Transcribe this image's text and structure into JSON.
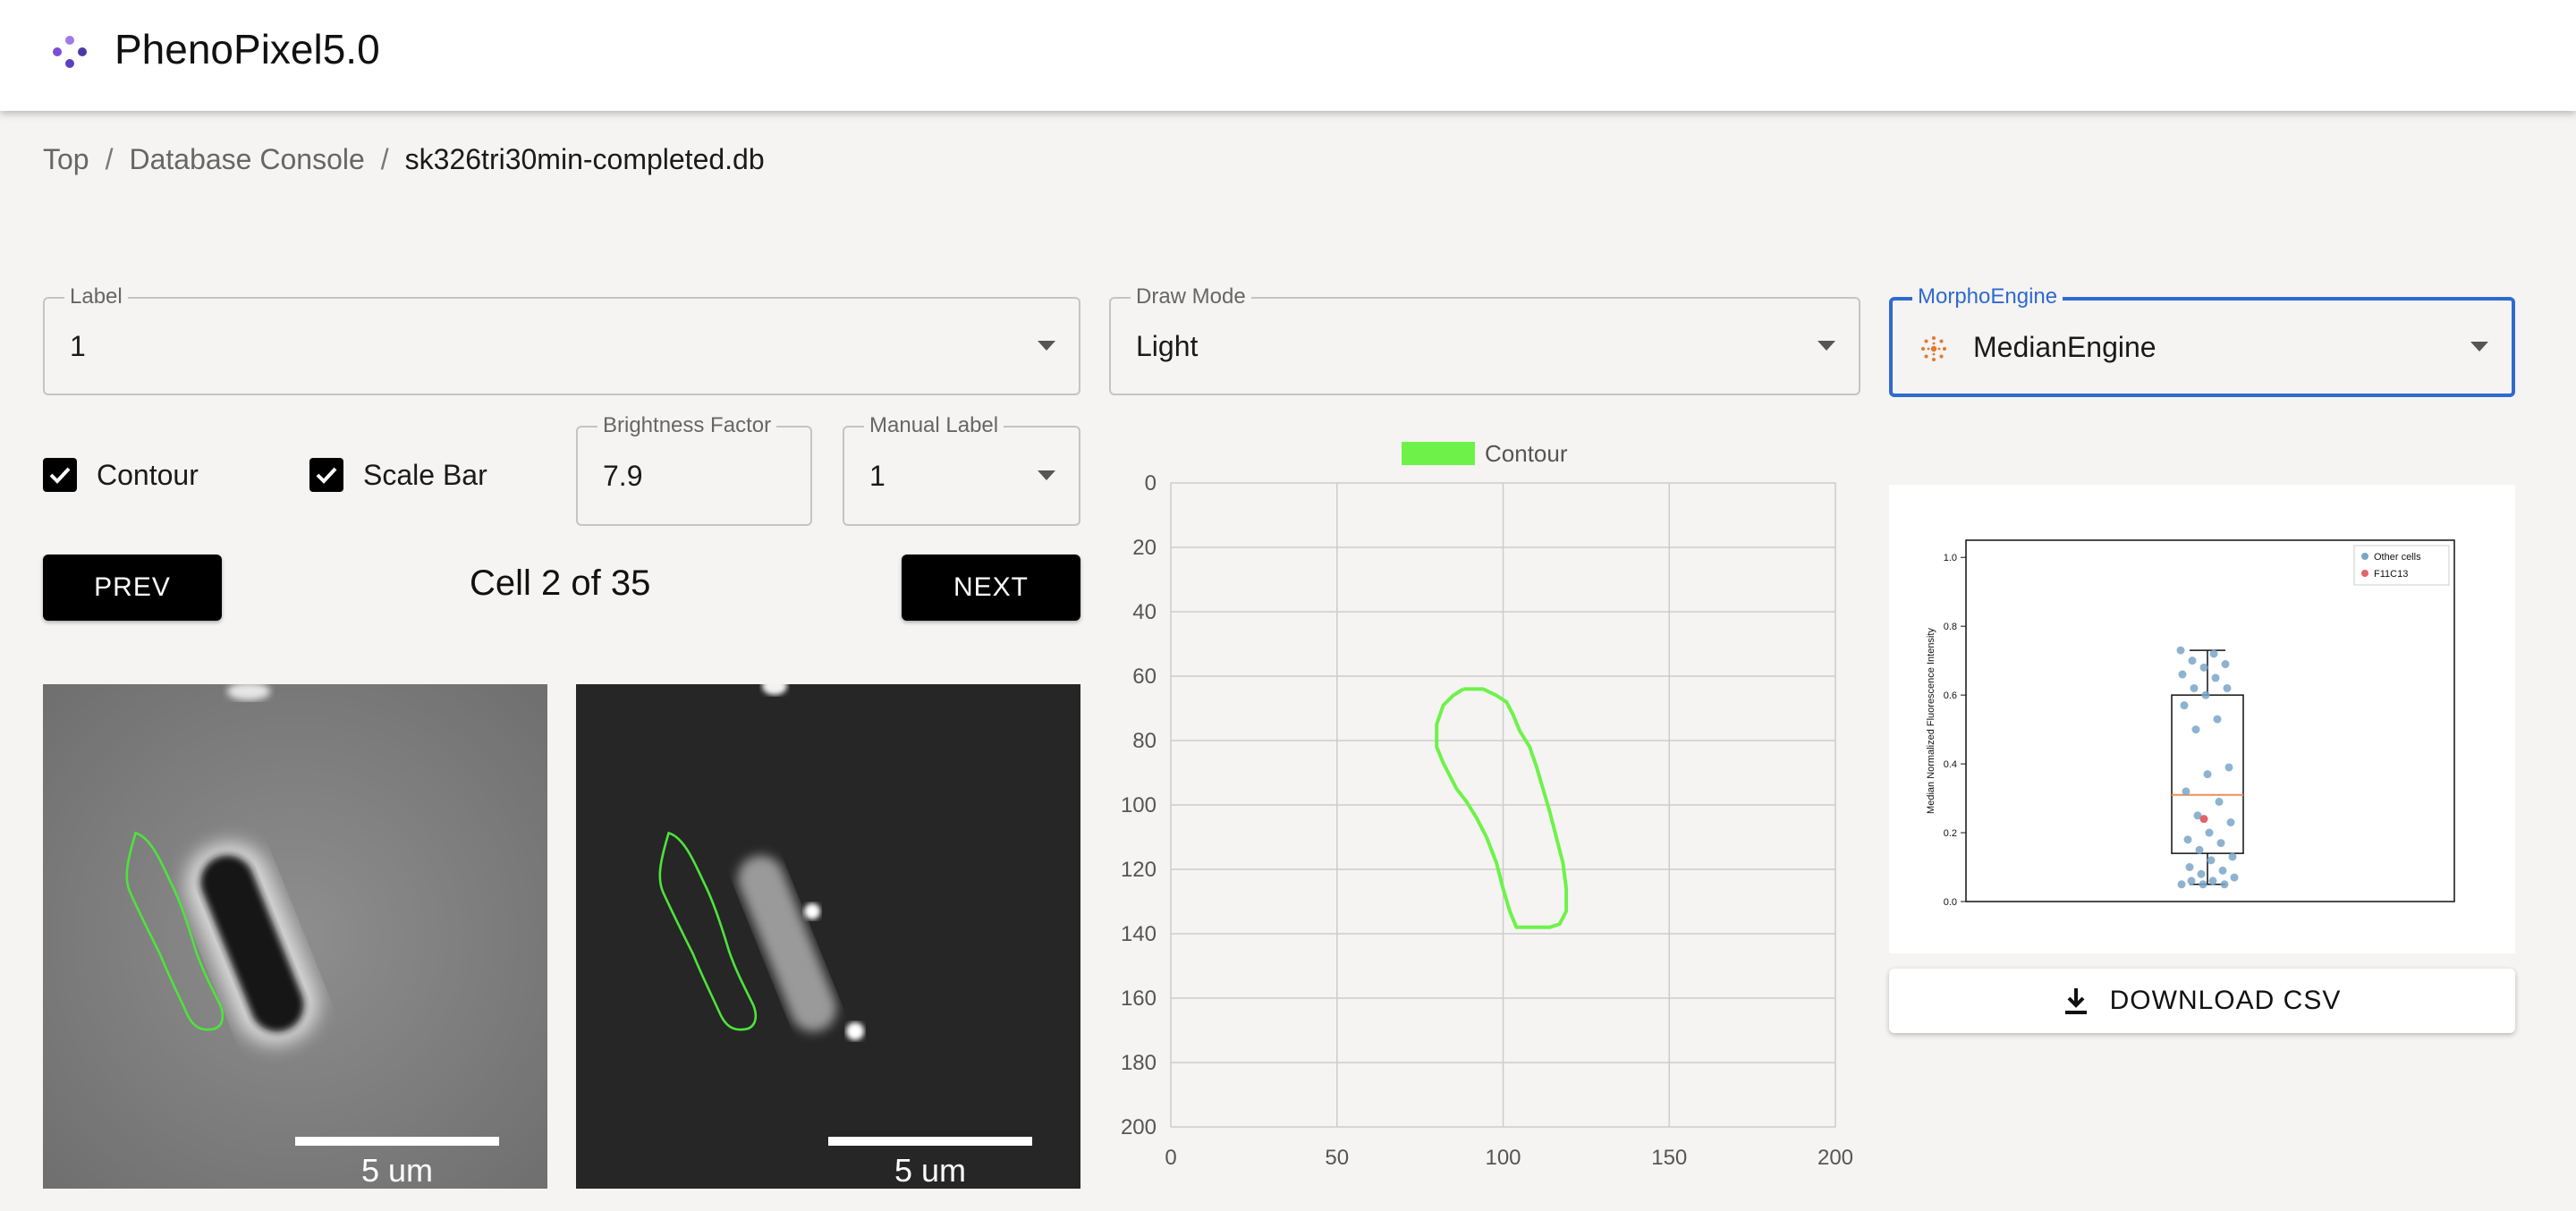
{
  "app": {
    "title": "PhenoPixel5.0"
  },
  "breadcrumb": {
    "items": [
      "Top",
      "Database Console",
      "sk326tri30min-completed.db"
    ],
    "separator": "/"
  },
  "label_select": {
    "label": "Label",
    "value": "1"
  },
  "draw_mode_select": {
    "label": "Draw Mode",
    "value": "Light"
  },
  "engine_select": {
    "label": "MorphoEngine",
    "value": "MedianEngine",
    "icon": "engine-icon"
  },
  "contour_checkbox": {
    "label": "Contour",
    "checked": true
  },
  "scalebar_checkbox": {
    "label": "Scale Bar",
    "checked": true
  },
  "brightness_field": {
    "label": "Brightness Factor",
    "value": "7.9"
  },
  "manual_label_select": {
    "label": "Manual Label",
    "value": "1"
  },
  "nav": {
    "prev_label": "PREV",
    "next_label": "NEXT",
    "cell_counter": "Cell 2 of 35"
  },
  "images": {
    "phase_scale_label": "5 um",
    "fluor_scale_label": "5 um"
  },
  "colors": {
    "accent": "#2f6ad0",
    "contour": "#6ef24a",
    "median_line": "#f28c52",
    "highlight_point": "#e0636a",
    "points": "#7aa6c8"
  },
  "chart_data": [
    {
      "type": "line",
      "title": "",
      "legend": [
        "Contour"
      ],
      "legend_position": "top-center",
      "xlim": [
        0,
        200
      ],
      "ylim": [
        200,
        0
      ],
      "x_ticks": [
        0,
        50,
        100,
        150,
        200
      ],
      "y_ticks": [
        0,
        20,
        40,
        60,
        80,
        100,
        120,
        140,
        160,
        180,
        200
      ],
      "grid": true,
      "series": [
        {
          "name": "Contour",
          "x": [
            88,
            94,
            98,
            101,
            103,
            105,
            108,
            110,
            112,
            114,
            116,
            118,
            119,
            119,
            117,
            114,
            109,
            104,
            102,
            100,
            98,
            95,
            92,
            89,
            86,
            84,
            82,
            80,
            80,
            82,
            85,
            88
          ],
          "y": [
            64,
            64,
            66,
            68,
            72,
            77,
            82,
            88,
            95,
            102,
            110,
            118,
            126,
            133,
            137,
            138,
            138,
            138,
            133,
            126,
            118,
            110,
            104,
            99,
            95,
            91,
            87,
            82,
            75,
            69,
            66,
            64
          ]
        }
      ]
    },
    {
      "type": "scatter",
      "ylabel": "Median Normalized Fluorescence Intensity",
      "ylim": [
        0,
        1.05
      ],
      "y_ticks": [
        "0.0",
        "0.2",
        "0.4",
        "0.6",
        "0.8",
        "1.0"
      ],
      "legend": [
        "Other cells",
        "F11C13"
      ],
      "legend_position": "top-right",
      "box": {
        "q1": 0.14,
        "median": 0.31,
        "q3": 0.6,
        "whisker_low": 0.05,
        "whisker_high": 0.73
      },
      "series": [
        {
          "name": "Other cells",
          "values": [
            0.73,
            0.72,
            0.7,
            0.69,
            0.68,
            0.66,
            0.65,
            0.62,
            0.62,
            0.6,
            0.57,
            0.53,
            0.5,
            0.39,
            0.37,
            0.32,
            0.29,
            0.25,
            0.23,
            0.2,
            0.18,
            0.17,
            0.15,
            0.13,
            0.12,
            0.1,
            0.09,
            0.08,
            0.07,
            0.06,
            0.06,
            0.05,
            0.05,
            0.05
          ]
        },
        {
          "name": "F11C13",
          "values": [
            0.24
          ]
        }
      ]
    }
  ],
  "download": {
    "label": "DOWNLOAD CSV",
    "icon": "download-icon"
  }
}
